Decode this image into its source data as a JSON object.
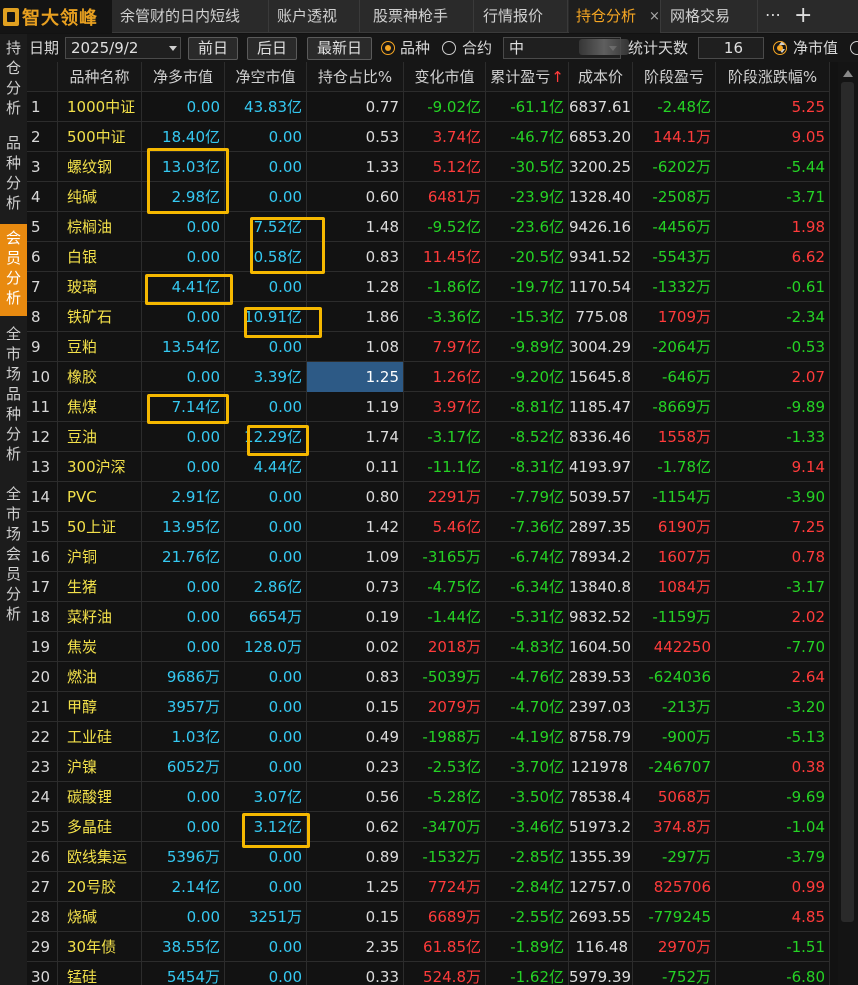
{
  "app": {
    "logo_text": "智大领峰"
  },
  "tabs": [
    {
      "label": "余管财的日内短线"
    },
    {
      "label": "账户透视"
    },
    {
      "label": "股票神枪手"
    },
    {
      "label": "行情报价"
    },
    {
      "label": "持仓分析",
      "active": true,
      "close": "×"
    },
    {
      "label": "网格交易"
    }
  ],
  "tabbar": {
    "more": "⋯",
    "add": "+"
  },
  "leftnav": [
    {
      "label": "持仓分析"
    },
    {
      "label": "品种分析"
    },
    {
      "label": "会员分析",
      "active": true
    },
    {
      "label": "全市场品种分析"
    },
    {
      "label": "全市场会员分析"
    }
  ],
  "filter": {
    "date_label": "日期",
    "date_value": "2025/9/2",
    "prev_day": "前日",
    "next_day": "后日",
    "latest_day": "最新日",
    "radio_variety": "品种",
    "radio_contract": "合约",
    "member_value": "中",
    "stat_days_label": "统计天数",
    "stat_days_value": "16",
    "radio_net": "净市值"
  },
  "table": {
    "columns": [
      "",
      "品种名称",
      "净多市值",
      "净空市值",
      "持仓占比%",
      "变化市值",
      "累计盈亏",
      "成本价",
      "阶段盈亏",
      "阶段涨跌幅%"
    ],
    "sort_arrow": "↑",
    "rows": [
      [
        "1",
        "1000中证",
        "0.00",
        "43.83亿",
        "0.77",
        "-9.02亿",
        "-61.1亿",
        "6837.61",
        "-2.48亿",
        "5.25"
      ],
      [
        "2",
        "500中证",
        "18.40亿",
        "0.00",
        "0.53",
        "3.74亿",
        "-46.7亿",
        "6853.20",
        "144.1万",
        "9.05"
      ],
      [
        "3",
        "螺纹钢",
        "13.03亿",
        "0.00",
        "1.33",
        "5.12亿",
        "-30.5亿",
        "3200.25",
        "-6202万",
        "-5.44"
      ],
      [
        "4",
        "纯碱",
        "2.98亿",
        "0.00",
        "0.60",
        "6481万",
        "-23.9亿",
        "1328.40",
        "-2508万",
        "-3.71"
      ],
      [
        "5",
        "棕榈油",
        "0.00",
        "7.52亿",
        "1.48",
        "-9.52亿",
        "-23.6亿",
        "9426.16",
        "-4456万",
        "1.98"
      ],
      [
        "6",
        "白银",
        "0.00",
        "0.58亿",
        "0.83",
        "11.45亿",
        "-20.5亿",
        "9341.52",
        "-5543万",
        "6.62"
      ],
      [
        "7",
        "玻璃",
        "4.41亿",
        "0.00",
        "1.28",
        "-1.86亿",
        "-19.7亿",
        "1170.54",
        "-1332万",
        "-0.61"
      ],
      [
        "8",
        "铁矿石",
        "0.00",
        "10.91亿",
        "1.86",
        "-3.36亿",
        "-15.3亿",
        "775.08",
        "1709万",
        "-2.34"
      ],
      [
        "9",
        "豆粕",
        "13.54亿",
        "0.00",
        "1.08",
        "7.97亿",
        "-9.89亿",
        "3004.29",
        "-2064万",
        "-0.53"
      ],
      [
        "10",
        "橡胶",
        "0.00",
        "3.39亿",
        "1.25",
        "1.26亿",
        "-9.20亿",
        "15645.8",
        "-646万",
        "2.07"
      ],
      [
        "11",
        "焦煤",
        "7.14亿",
        "0.00",
        "1.19",
        "3.97亿",
        "-8.81亿",
        "1185.47",
        "-8669万",
        "-9.89"
      ],
      [
        "12",
        "豆油",
        "0.00",
        "12.29亿",
        "1.74",
        "-3.17亿",
        "-8.52亿",
        "8336.46",
        "1558万",
        "-1.33"
      ],
      [
        "13",
        "300沪深",
        "0.00",
        "4.44亿",
        "0.11",
        "-11.1亿",
        "-8.31亿",
        "4193.97",
        "-1.78亿",
        "9.14"
      ],
      [
        "14",
        "PVC",
        "2.91亿",
        "0.00",
        "0.80",
        "2291万",
        "-7.79亿",
        "5039.57",
        "-1154万",
        "-3.90"
      ],
      [
        "15",
        "50上证",
        "13.95亿",
        "0.00",
        "1.42",
        "5.46亿",
        "-7.36亿",
        "2897.35",
        "6190万",
        "7.25"
      ],
      [
        "16",
        "沪铜",
        "21.76亿",
        "0.00",
        "1.09",
        "-3165万",
        "-6.74亿",
        "78934.2",
        "1607万",
        "0.78"
      ],
      [
        "17",
        "生猪",
        "0.00",
        "2.86亿",
        "0.73",
        "-4.75亿",
        "-6.34亿",
        "13840.8",
        "1084万",
        "-3.17"
      ],
      [
        "18",
        "菜籽油",
        "0.00",
        "6654万",
        "0.19",
        "-1.44亿",
        "-5.31亿",
        "9832.52",
        "-1159万",
        "2.02"
      ],
      [
        "19",
        "焦炭",
        "0.00",
        "128.0万",
        "0.02",
        "2018万",
        "-4.83亿",
        "1604.50",
        "442250",
        "-7.70"
      ],
      [
        "20",
        "燃油",
        "9686万",
        "0.00",
        "0.83",
        "-5039万",
        "-4.76亿",
        "2839.53",
        "-624036",
        "2.64"
      ],
      [
        "21",
        "甲醇",
        "3957万",
        "0.00",
        "0.15",
        "2079万",
        "-4.70亿",
        "2397.03",
        "-213万",
        "-3.20"
      ],
      [
        "22",
        "工业硅",
        "1.03亿",
        "0.00",
        "0.49",
        "-1988万",
        "-4.19亿",
        "8758.79",
        "-900万",
        "-5.13"
      ],
      [
        "23",
        "沪镍",
        "6052万",
        "0.00",
        "0.23",
        "-2.53亿",
        "-3.70亿",
        "121978",
        "-246707",
        "0.38"
      ],
      [
        "24",
        "碳酸锂",
        "0.00",
        "3.07亿",
        "0.56",
        "-5.28亿",
        "-3.50亿",
        "78538.4",
        "5068万",
        "-9.69"
      ],
      [
        "25",
        "多晶硅",
        "0.00",
        "3.12亿",
        "0.62",
        "-3470万",
        "-3.46亿",
        "51973.2",
        "374.8万",
        "-1.04"
      ],
      [
        "26",
        "欧线集运",
        "5396万",
        "0.00",
        "0.89",
        "-1532万",
        "-2.85亿",
        "1355.39",
        "-297万",
        "-3.79"
      ],
      [
        "27",
        "20号胶",
        "2.14亿",
        "0.00",
        "1.25",
        "7724万",
        "-2.84亿",
        "12757.0",
        "825706",
        "0.99"
      ],
      [
        "28",
        "烧碱",
        "0.00",
        "3251万",
        "0.15",
        "6689万",
        "-2.55亿",
        "2693.55",
        "-779245",
        "4.85"
      ],
      [
        "29",
        "30年债",
        "38.55亿",
        "0.00",
        "2.35",
        "61.85亿",
        "-1.89亿",
        "116.48",
        "2970万",
        "-1.51"
      ],
      [
        "30",
        "锰硅",
        "5454万",
        "0.00",
        "0.33",
        "524.8万",
        "-1.62亿",
        "5979.39",
        "-752万",
        "-6.80"
      ]
    ]
  }
}
